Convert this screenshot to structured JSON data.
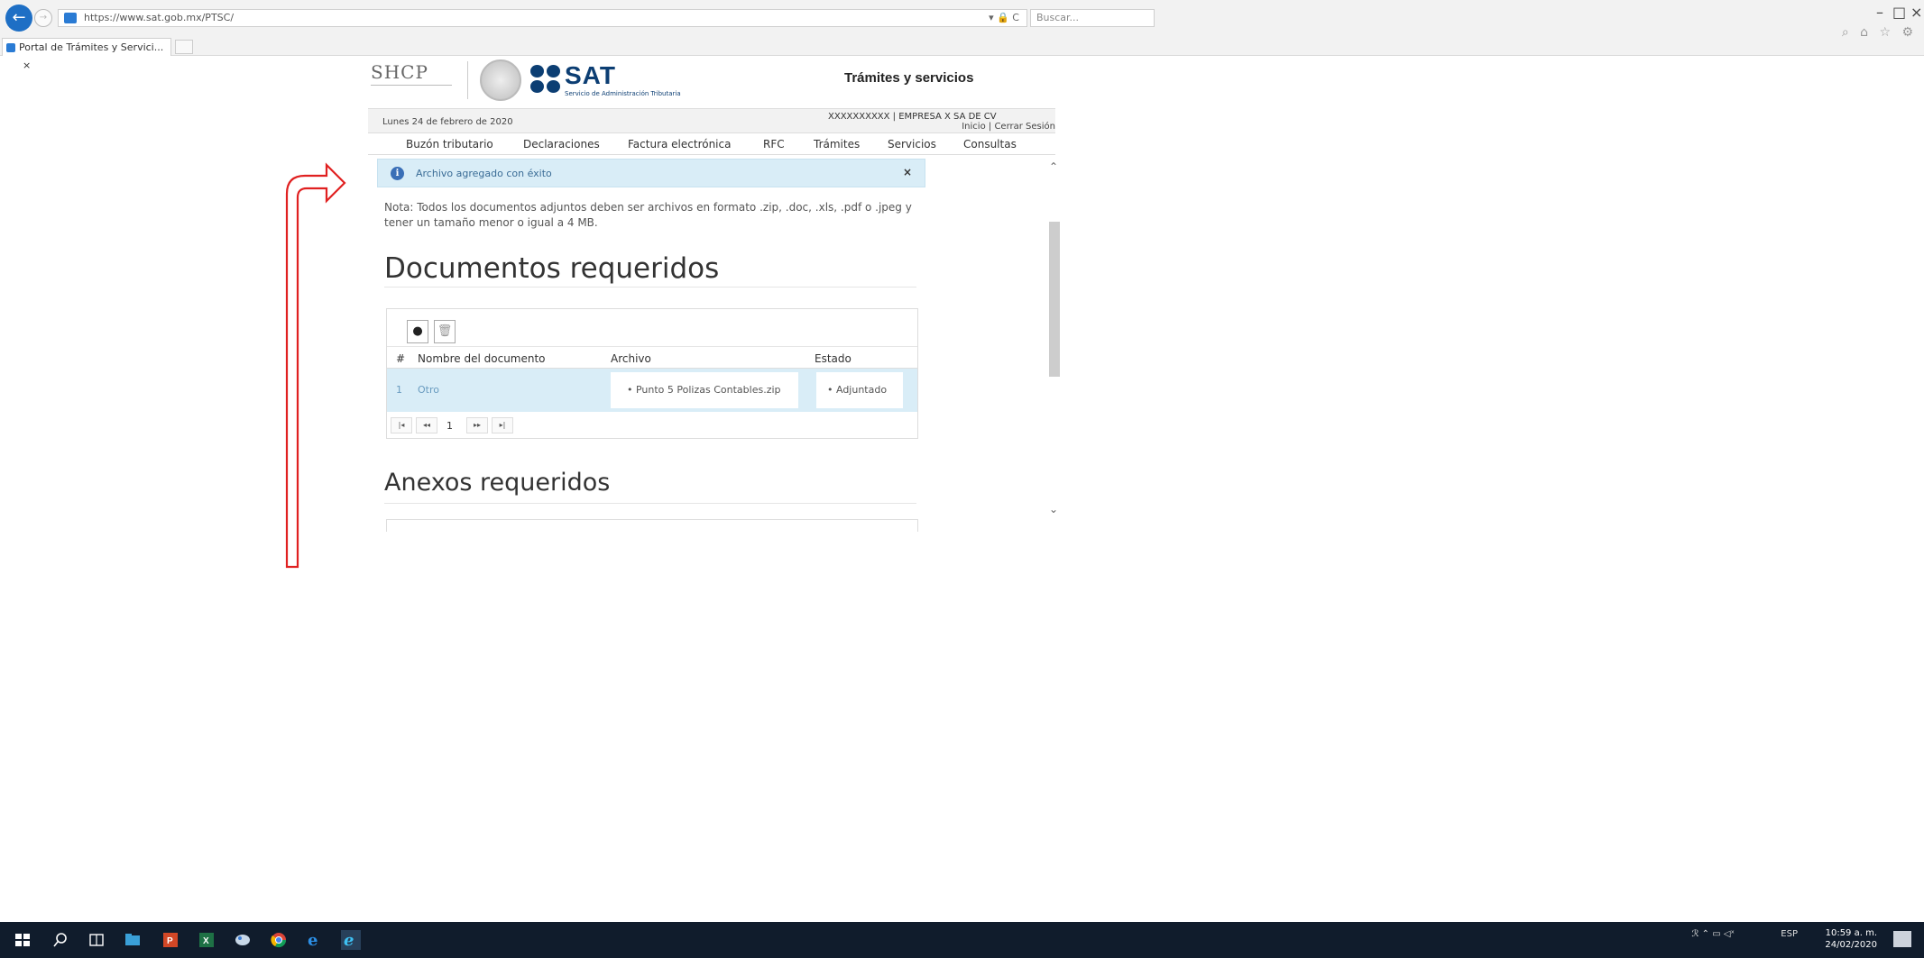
{
  "browser": {
    "url": "https://www.sat.gob.mx/PTSC/",
    "search_placeholder": "Buscar...",
    "tab_title": "Portal de Trámites y Servici...",
    "tab_close": "×",
    "addr_tools": "▾ 🔒 C"
  },
  "header": {
    "shcp": "SHCP",
    "sat_logo": "SAT",
    "sat_subtitle": "Servicio de Administración Tributaria",
    "section_title": "Trámites y servicios"
  },
  "info_bar": {
    "date": "Lunes 24 de febrero de 2020",
    "company": "XXXXXXXXXX  |  EMPRESA X SA DE CV",
    "inicio": "Inicio",
    "separator": "|",
    "cerrar": "Cerrar Sesión"
  },
  "nav": {
    "items": [
      "Buzón tributario",
      "Declaraciones",
      "Factura electrónica",
      "RFC",
      "Trámites",
      "Servicios",
      "Consultas"
    ]
  },
  "alert": {
    "message": "Archivo agregado con éxito",
    "close": "×",
    "icon": "info-icon"
  },
  "note": "Nota: Todos los documentos adjuntos deben ser archivos en formato .zip, .doc, .xls, .pdf o .jpeg y tener un tamaño menor o igual a 4 MB.",
  "docs_section": {
    "title": "Documentos requeridos",
    "columns": [
      "#",
      "Nombre del documento",
      "Archivo",
      "Estado"
    ],
    "rows": [
      {
        "num": "1",
        "name": "Otro",
        "file": "• Punto 5 Polizas Contables.zip",
        "state": "• Adjuntado"
      }
    ],
    "pager": {
      "first": "|◂",
      "prev": "◂◂",
      "page": "1",
      "next": "▸▸",
      "last": "▸|"
    }
  },
  "anexos_section": {
    "title": "Anexos requeridos"
  },
  "taskbar": {
    "clock_time": "10:59 a. m.",
    "clock_date": "24/02/2020",
    "lang": "ESP"
  }
}
